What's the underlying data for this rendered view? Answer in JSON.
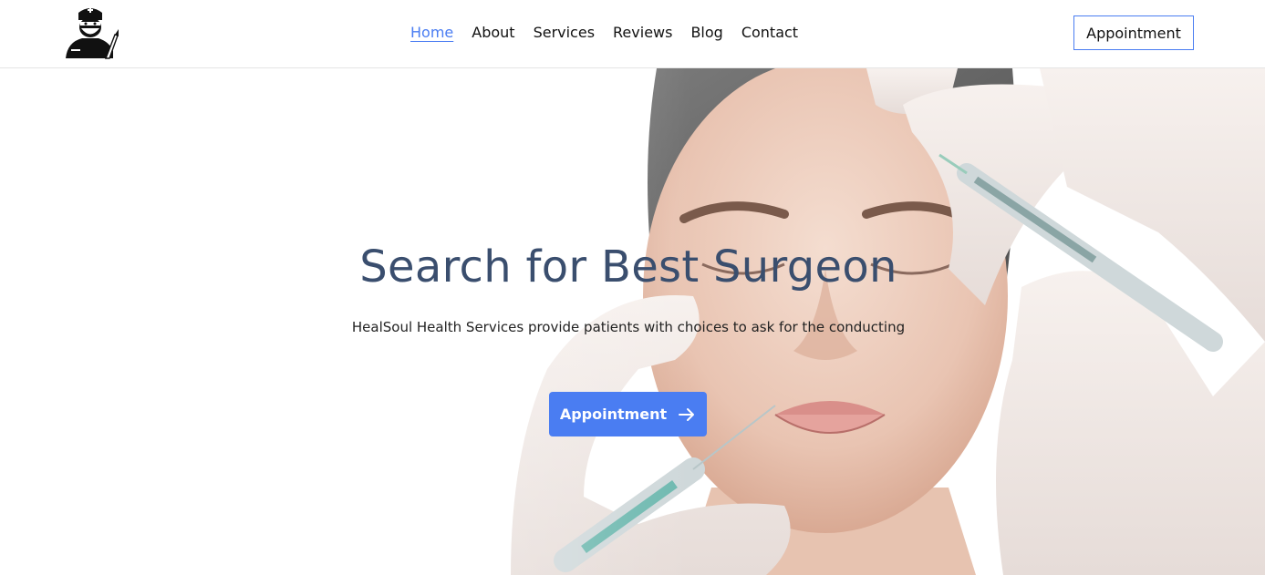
{
  "header": {
    "logo_icon": "surgeon-logo-icon",
    "nav": [
      {
        "label": "Home",
        "active": true
      },
      {
        "label": "About",
        "active": false
      },
      {
        "label": "Services",
        "active": false
      },
      {
        "label": "Reviews",
        "active": false
      },
      {
        "label": "Blog",
        "active": false
      },
      {
        "label": "Contact",
        "active": false
      }
    ],
    "appointment_label": "Appointment"
  },
  "hero": {
    "title": "Search for Best Surgeon",
    "subtitle": "HealSoul Health Services provide patients with choices to ask for the conducting",
    "cta_label": "Appointment",
    "cta_icon": "arrow-right-icon",
    "image_subject": "face-injection-photo"
  },
  "colors": {
    "accent": "#4a7df2",
    "title": "#3a4e6e"
  }
}
